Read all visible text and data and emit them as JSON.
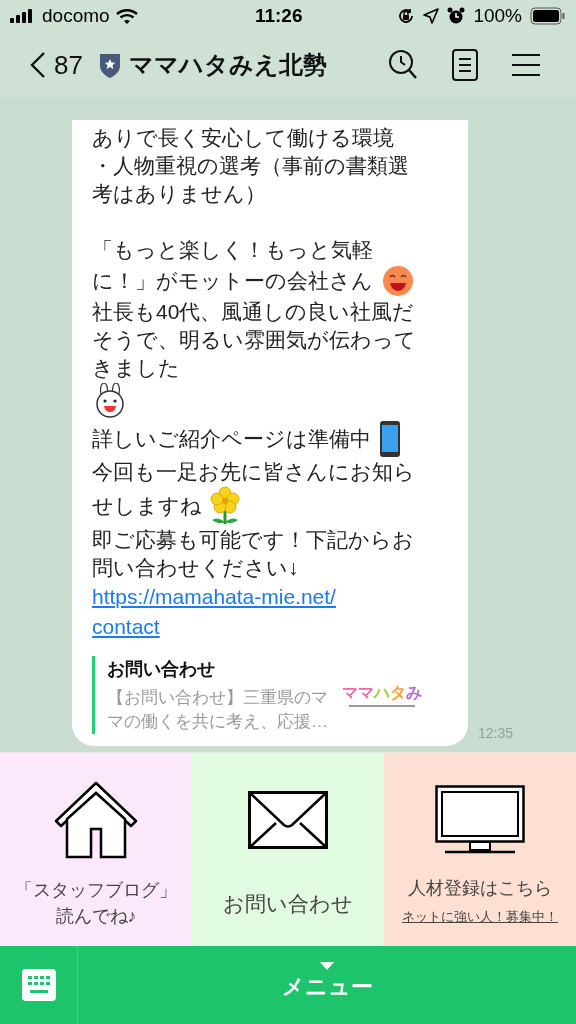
{
  "status_bar": {
    "carrier": "docomo",
    "time": "11:26",
    "battery": "100%"
  },
  "header": {
    "back_count": "87",
    "title": "ママハタみえ北勢"
  },
  "message": {
    "lines": [
      {
        "kind": "text",
        "text": "ありで長く安心して働ける環境"
      },
      {
        "kind": "text",
        "text": "・人物重視の選考（事前の書類選"
      },
      {
        "kind": "text",
        "text": "考はありません）"
      },
      {
        "kind": "blank"
      },
      {
        "kind": "text",
        "text": "「もっと楽しく！もっと気軽"
      },
      {
        "kind": "text",
        "text": "に！」がモットーの会社さん",
        "trailing": {
          "kind": "smiley"
        }
      },
      {
        "kind": "text",
        "text": "社長も40代、風通しの良い社風だ"
      },
      {
        "kind": "text",
        "text": "そうで、明るい雰囲気が伝わって"
      },
      {
        "kind": "text",
        "text": "きました"
      },
      {
        "kind": "sticker",
        "sticker": {
          "kind": "rabbit"
        }
      },
      {
        "kind": "text",
        "text": "詳しいご紹介ページは準備中",
        "trailing": {
          "kind": "phone"
        }
      },
      {
        "kind": "text",
        "text": "今回も一足お先に皆さんにお知ら"
      },
      {
        "kind": "text",
        "text": "せしますね",
        "trailing": {
          "kind": "flower"
        }
      },
      {
        "kind": "text",
        "text": "即ご応募も可能です！下記からお"
      },
      {
        "kind": "text",
        "text": "問い合わせください↓"
      },
      {
        "kind": "link",
        "lines": [
          "https://mamahata-mie.net/",
          "contact"
        ]
      }
    ],
    "preview": {
      "title": "お問い合わせ",
      "description": [
        "【お問い合わせ】三重県のマ",
        "マの働くを共に考え、応援…"
      ],
      "logo": "ママハタみ"
    },
    "time": "12:35"
  },
  "rich_menu": [
    {
      "kind": "house",
      "lines": [
        "「スタッフブログ」",
        "読んでね♪"
      ],
      "color": "#fbe8fb"
    },
    {
      "kind": "envelope",
      "lines": [
        "お問い合わせ"
      ],
      "color": "#e0fbdf"
    },
    {
      "kind": "monitor",
      "lines": [
        "人材登録はこちら"
      ],
      "subtext": "ネットに強い人！募集中！",
      "color": "#fde0d1"
    }
  ],
  "bottom_bar": {
    "label": "メニュー"
  }
}
